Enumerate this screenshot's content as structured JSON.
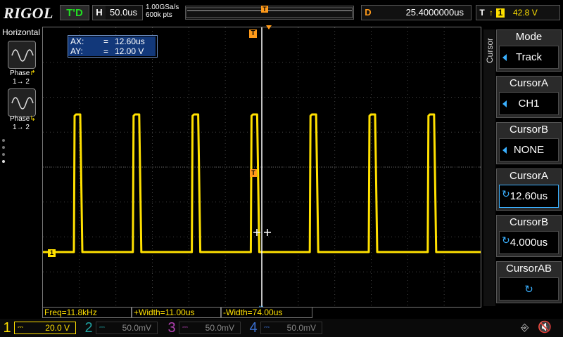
{
  "topbar": {
    "logo": "RIGOL",
    "trigger_status": "T'D",
    "horizontal": {
      "label": "H",
      "value": "50.0us"
    },
    "sample_rate": "1.00GSa/s",
    "memory_depth": "600k pts",
    "trigger_position_marker": "T",
    "delay": {
      "label": "D",
      "value": "25.4000000us"
    },
    "trigger": {
      "label": "T",
      "edge": "↑",
      "source": "1",
      "level": "42.8 V"
    }
  },
  "left_panel": {
    "title": "Horizontal",
    "modes": [
      {
        "label": "Phase",
        "sub": "1→ 2",
        "icon": "rising-phase-icon"
      },
      {
        "label": "Phase",
        "sub": "1→ 2",
        "icon": "falling-phase-icon"
      }
    ]
  },
  "cursor_readout": {
    "ax_label": "AX:",
    "ax_value": "12.60us",
    "ay_label": "AY:",
    "ay_value": "12.00 V",
    "eq": "="
  },
  "waveform": {
    "channel": "1",
    "color": "#ffe000",
    "pulse_count": 7,
    "trigger_marker": "T",
    "cursor_marker": "T"
  },
  "menu": {
    "side_label": "Cursor",
    "buttons": [
      {
        "title": "Mode",
        "value": "Track",
        "kind": "arrow"
      },
      {
        "title": "CursorA",
        "value": "CH1",
        "kind": "arrow"
      },
      {
        "title": "CursorB",
        "value": "NONE",
        "kind": "arrow"
      },
      {
        "title": "CursorA",
        "value": "12.60us",
        "kind": "knob",
        "selected": true
      },
      {
        "title": "CursorB",
        "value": "4.000us",
        "kind": "knob"
      },
      {
        "title": "CursorAB",
        "value": "",
        "kind": "knob"
      }
    ]
  },
  "measurements": [
    {
      "text": "Freq=11.8kHz"
    },
    {
      "text": "+Width=11.00us"
    },
    {
      "text": "-Width=74.00us"
    }
  ],
  "channels": [
    {
      "num": "1",
      "value": "20.0 V",
      "color": "#ffe000",
      "active": true
    },
    {
      "num": "2",
      "value": "50.0mV",
      "color": "#1fa0a0",
      "active": false
    },
    {
      "num": "3",
      "value": "50.0mV",
      "color": "#b040b0",
      "active": false
    },
    {
      "num": "4",
      "value": "50.0mV",
      "color": "#3a6fd0",
      "active": false
    }
  ],
  "colors": {
    "ch1": "#ffe000",
    "trigger": "#ff9a1a",
    "accent": "#3ab0ff"
  }
}
